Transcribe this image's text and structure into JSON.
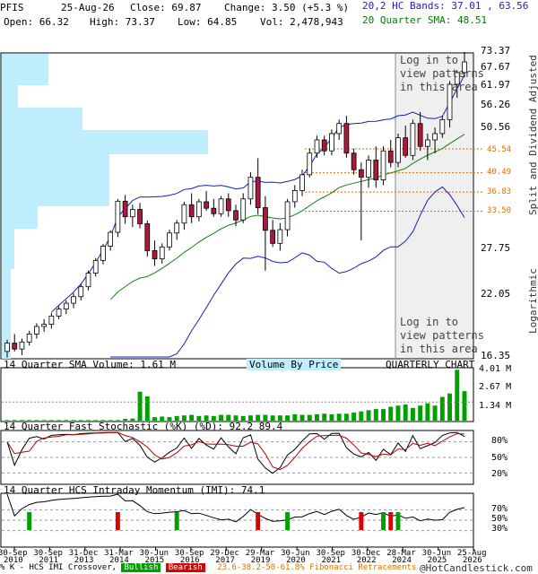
{
  "header": {
    "symbol": "PFIS",
    "date": "25-Aug-26",
    "close": "Close: 69.87",
    "change": "Change: 3.50 (+5.3 %)",
    "open": "Open: 66.32",
    "high": "High: 73.37",
    "low": "Low: 64.85",
    "vol": "Vol: 2,478,943",
    "bands": "20,2 HC Bands: 37.01 , 63.56",
    "sma": "20 Quarter SMA: 48.51"
  },
  "price_panel": {
    "y_ticks": [
      "73.37",
      "67.67",
      "61.97",
      "56.26",
      "50.56",
      "27.75",
      "22.05",
      "16.35"
    ],
    "fib_labels": [
      "45.54",
      "40.49",
      "36.83",
      "33.50"
    ],
    "overlay_text": [
      "Log in to",
      "view patterns",
      "in this area"
    ],
    "right_vertical_labels": [
      "Split and Dividend Adjusted",
      "Logarithmic"
    ]
  },
  "volume_panel": {
    "title": "14 Quarter SMA Volume: 1.61 M",
    "center_label": "Volume By Price",
    "right_label": "QUARTERLY CHART",
    "y_ticks": [
      "4.01 M",
      "2.67 M",
      "1.34 M"
    ]
  },
  "stoch_panel": {
    "title": "14 Quarter Fast Stochastic (%K) (%D): 92.2  89.4",
    "y_ticks": [
      "80%",
      "50%",
      "20%"
    ]
  },
  "imi_panel": {
    "title": "14 Quarter HCS Intraday Momentum (IMI): 74.1",
    "y_ticks": [
      "70%",
      "50%",
      "30%"
    ]
  },
  "x_axis": {
    "top_labels": [
      "30-Sep",
      "30-Sep",
      "31-Dec",
      "31-Mar",
      "30-Jun",
      "30-Sep",
      "29-Dec",
      "29-Mar",
      "30-Jun",
      "30-Sep",
      "30-Dec",
      "28-Mar",
      "30-Jun",
      "25-Aug"
    ],
    "bottom_labels": [
      "2010",
      "2011",
      "2013",
      "2014",
      "2015",
      "2016",
      "2017",
      "2019",
      "2020",
      "2021",
      "2022",
      "2024",
      "2025",
      "2026"
    ]
  },
  "footer": {
    "prefix": "% K - HCS IMI Crossover,",
    "bullish": "Bullish",
    "bearish": "Bearish",
    "fib_note": "23.6-38.2-50-61.8% Fibonacci Retracements",
    "credit": "@HotCandlestick.com"
  },
  "colors": {
    "up": "#ffffff",
    "down": "#aa1a3a",
    "bands": "#1020c0",
    "sma": "#108010",
    "volume_by_price": "#bfefff",
    "bullish": "#00a000",
    "bearish": "#e00000",
    "fib": "#e07000"
  },
  "chart_data": {
    "type": "candlestick",
    "frequency": "quarterly",
    "y_scale": "log",
    "ylim": [
      16.35,
      73.37
    ],
    "ohlc": [
      [
        16.8,
        17.8,
        16.3,
        17.5
      ],
      [
        17.5,
        18.3,
        16.8,
        17.0
      ],
      [
        17.0,
        17.9,
        16.5,
        17.6
      ],
      [
        17.6,
        18.6,
        17.3,
        18.3
      ],
      [
        18.3,
        19.3,
        17.9,
        19.0
      ],
      [
        19.0,
        19.7,
        18.5,
        19.2
      ],
      [
        19.2,
        20.3,
        18.8,
        20.0
      ],
      [
        20.0,
        21.0,
        19.7,
        20.7
      ],
      [
        20.7,
        21.6,
        20.2,
        21.3
      ],
      [
        21.3,
        22.4,
        20.8,
        22.0
      ],
      [
        22.0,
        23.4,
        21.6,
        23.1
      ],
      [
        23.1,
        25.0,
        22.7,
        24.7
      ],
      [
        24.7,
        26.6,
        24.3,
        26.3
      ],
      [
        26.3,
        28.5,
        25.8,
        28.2
      ],
      [
        28.2,
        30.5,
        27.6,
        30.2
      ],
      [
        30.2,
        35.6,
        29.5,
        35.2
      ],
      [
        35.2,
        36.3,
        31.5,
        32.6
      ],
      [
        32.6,
        34.6,
        31.0,
        33.8
      ],
      [
        33.8,
        34.9,
        30.8,
        31.5
      ],
      [
        31.5,
        32.0,
        26.8,
        27.6
      ],
      [
        27.6,
        29.0,
        25.6,
        26.5
      ],
      [
        26.5,
        28.6,
        25.9,
        28.1
      ],
      [
        28.1,
        30.6,
        27.6,
        30.1
      ],
      [
        30.1,
        32.1,
        29.1,
        31.6
      ],
      [
        31.6,
        35.1,
        30.6,
        34.6
      ],
      [
        34.6,
        36.6,
        31.6,
        32.6
      ],
      [
        32.6,
        35.6,
        31.9,
        35.1
      ],
      [
        35.1,
        37.0,
        33.6,
        34.0
      ],
      [
        34.0,
        35.6,
        32.6,
        33.1
      ],
      [
        33.1,
        36.1,
        32.6,
        35.6
      ],
      [
        35.6,
        36.6,
        32.6,
        33.6
      ],
      [
        33.6,
        34.6,
        31.1,
        32.1
      ],
      [
        32.1,
        36.6,
        31.6,
        35.6
      ],
      [
        35.6,
        40.6,
        34.6,
        39.6
      ],
      [
        39.6,
        43.5,
        33.0,
        34.1
      ],
      [
        34.1,
        36.1,
        25.0,
        30.5
      ],
      [
        30.5,
        32.1,
        28.1,
        28.6
      ],
      [
        28.6,
        31.6,
        27.6,
        30.6
      ],
      [
        30.6,
        35.6,
        29.6,
        35.1
      ],
      [
        35.1,
        38.1,
        34.1,
        37.1
      ],
      [
        37.1,
        41.1,
        36.1,
        40.1
      ],
      [
        40.1,
        45.6,
        39.6,
        44.6
      ],
      [
        44.6,
        48.6,
        43.6,
        47.6
      ],
      [
        47.6,
        48.6,
        44.1,
        45.1
      ],
      [
        45.1,
        50.1,
        44.1,
        49.1
      ],
      [
        49.1,
        52.6,
        47.6,
        51.6
      ],
      [
        51.6,
        53.6,
        43.6,
        44.6
      ],
      [
        44.6,
        45.6,
        40.1,
        41.1
      ],
      [
        41.1,
        42.6,
        29.0,
        39.6
      ],
      [
        39.6,
        44.1,
        37.6,
        43.1
      ],
      [
        43.1,
        46.1,
        37.6,
        39.1
      ],
      [
        39.1,
        46.1,
        38.1,
        45.1
      ],
      [
        45.1,
        47.6,
        41.6,
        42.6
      ],
      [
        42.6,
        49.1,
        41.6,
        48.1
      ],
      [
        48.1,
        51.1,
        43.6,
        44.1
      ],
      [
        44.1,
        52.6,
        43.1,
        51.6
      ],
      [
        51.6,
        54.6,
        45.1,
        46.1
      ],
      [
        46.1,
        49.1,
        43.1,
        47.6
      ],
      [
        47.6,
        50.6,
        44.6,
        49.1
      ],
      [
        49.1,
        53.6,
        48.1,
        52.6
      ],
      [
        52.6,
        63.6,
        50.6,
        62.6
      ],
      [
        62.6,
        67.1,
        58.6,
        66.3
      ],
      [
        66.32,
        73.37,
        64.85,
        69.87
      ]
    ],
    "volume_millions": [
      0.05,
      0.05,
      0.05,
      0.05,
      0.05,
      0.05,
      0.05,
      0.05,
      0.05,
      0.05,
      0.05,
      0.05,
      0.05,
      0.05,
      0.05,
      0.05,
      0.15,
      0.18,
      2.5,
      2.1,
      0.3,
      0.35,
      0.3,
      0.4,
      0.45,
      0.5,
      0.4,
      0.45,
      0.4,
      0.5,
      0.5,
      0.45,
      0.4,
      0.45,
      0.5,
      0.5,
      0.45,
      0.45,
      0.45,
      0.55,
      0.5,
      0.5,
      0.55,
      0.6,
      0.55,
      0.6,
      0.6,
      0.7,
      0.8,
      0.9,
      1.0,
      1.0,
      1.2,
      1.3,
      1.4,
      1.1,
      1.3,
      1.5,
      1.3,
      2.05,
      2.35,
      4.4,
      2.55
    ]
  }
}
